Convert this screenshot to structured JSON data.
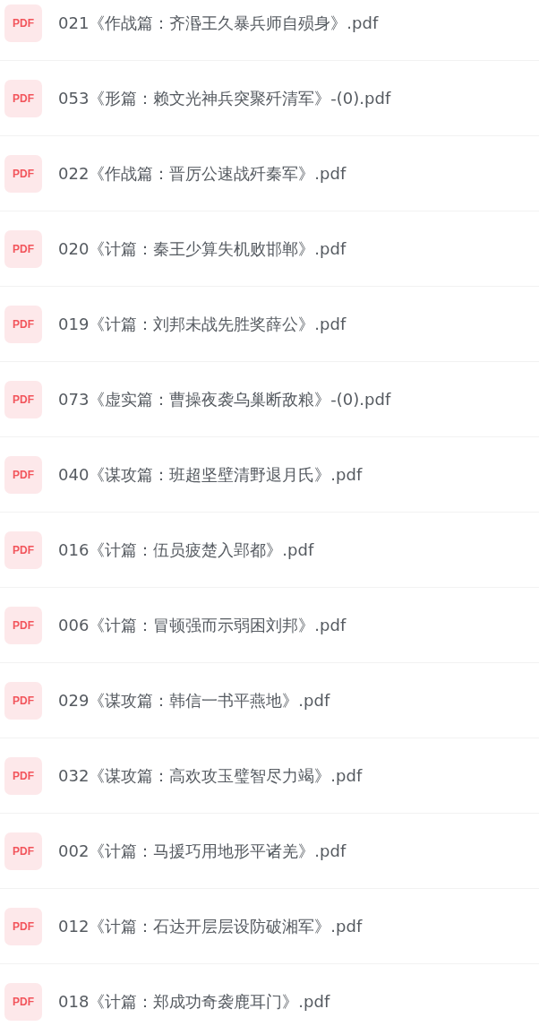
{
  "files": [
    {
      "badge": "PDF",
      "name": "021《作战篇：齐湣王久暴兵师自殒身》.pdf"
    },
    {
      "badge": "PDF",
      "name": "053《形篇：赖文光神兵突聚歼清军》-(0).pdf"
    },
    {
      "badge": "PDF",
      "name": "022《作战篇：晋厉公速战歼秦军》.pdf"
    },
    {
      "badge": "PDF",
      "name": "020《计篇：秦王少算失机败邯郸》.pdf"
    },
    {
      "badge": "PDF",
      "name": "019《计篇：刘邦未战先胜奖薛公》.pdf"
    },
    {
      "badge": "PDF",
      "name": "073《虚实篇：曹操夜袭乌巢断敌粮》-(0).pdf"
    },
    {
      "badge": "PDF",
      "name": "040《谋攻篇：班超坚壁清野退月氏》.pdf"
    },
    {
      "badge": "PDF",
      "name": "016《计篇：伍员疲楚入郢都》.pdf"
    },
    {
      "badge": "PDF",
      "name": "006《计篇：冒顿强而示弱困刘邦》.pdf"
    },
    {
      "badge": "PDF",
      "name": "029《谋攻篇：韩信一书平燕地》.pdf"
    },
    {
      "badge": "PDF",
      "name": "032《谋攻篇：高欢攻玉璧智尽力竭》.pdf"
    },
    {
      "badge": "PDF",
      "name": "002《计篇：马援巧用地形平诸羌》.pdf"
    },
    {
      "badge": "PDF",
      "name": "012《计篇：石达开层层设防破湘军》.pdf"
    },
    {
      "badge": "PDF",
      "name": "018《计篇：郑成功奇袭鹿耳门》.pdf"
    }
  ]
}
